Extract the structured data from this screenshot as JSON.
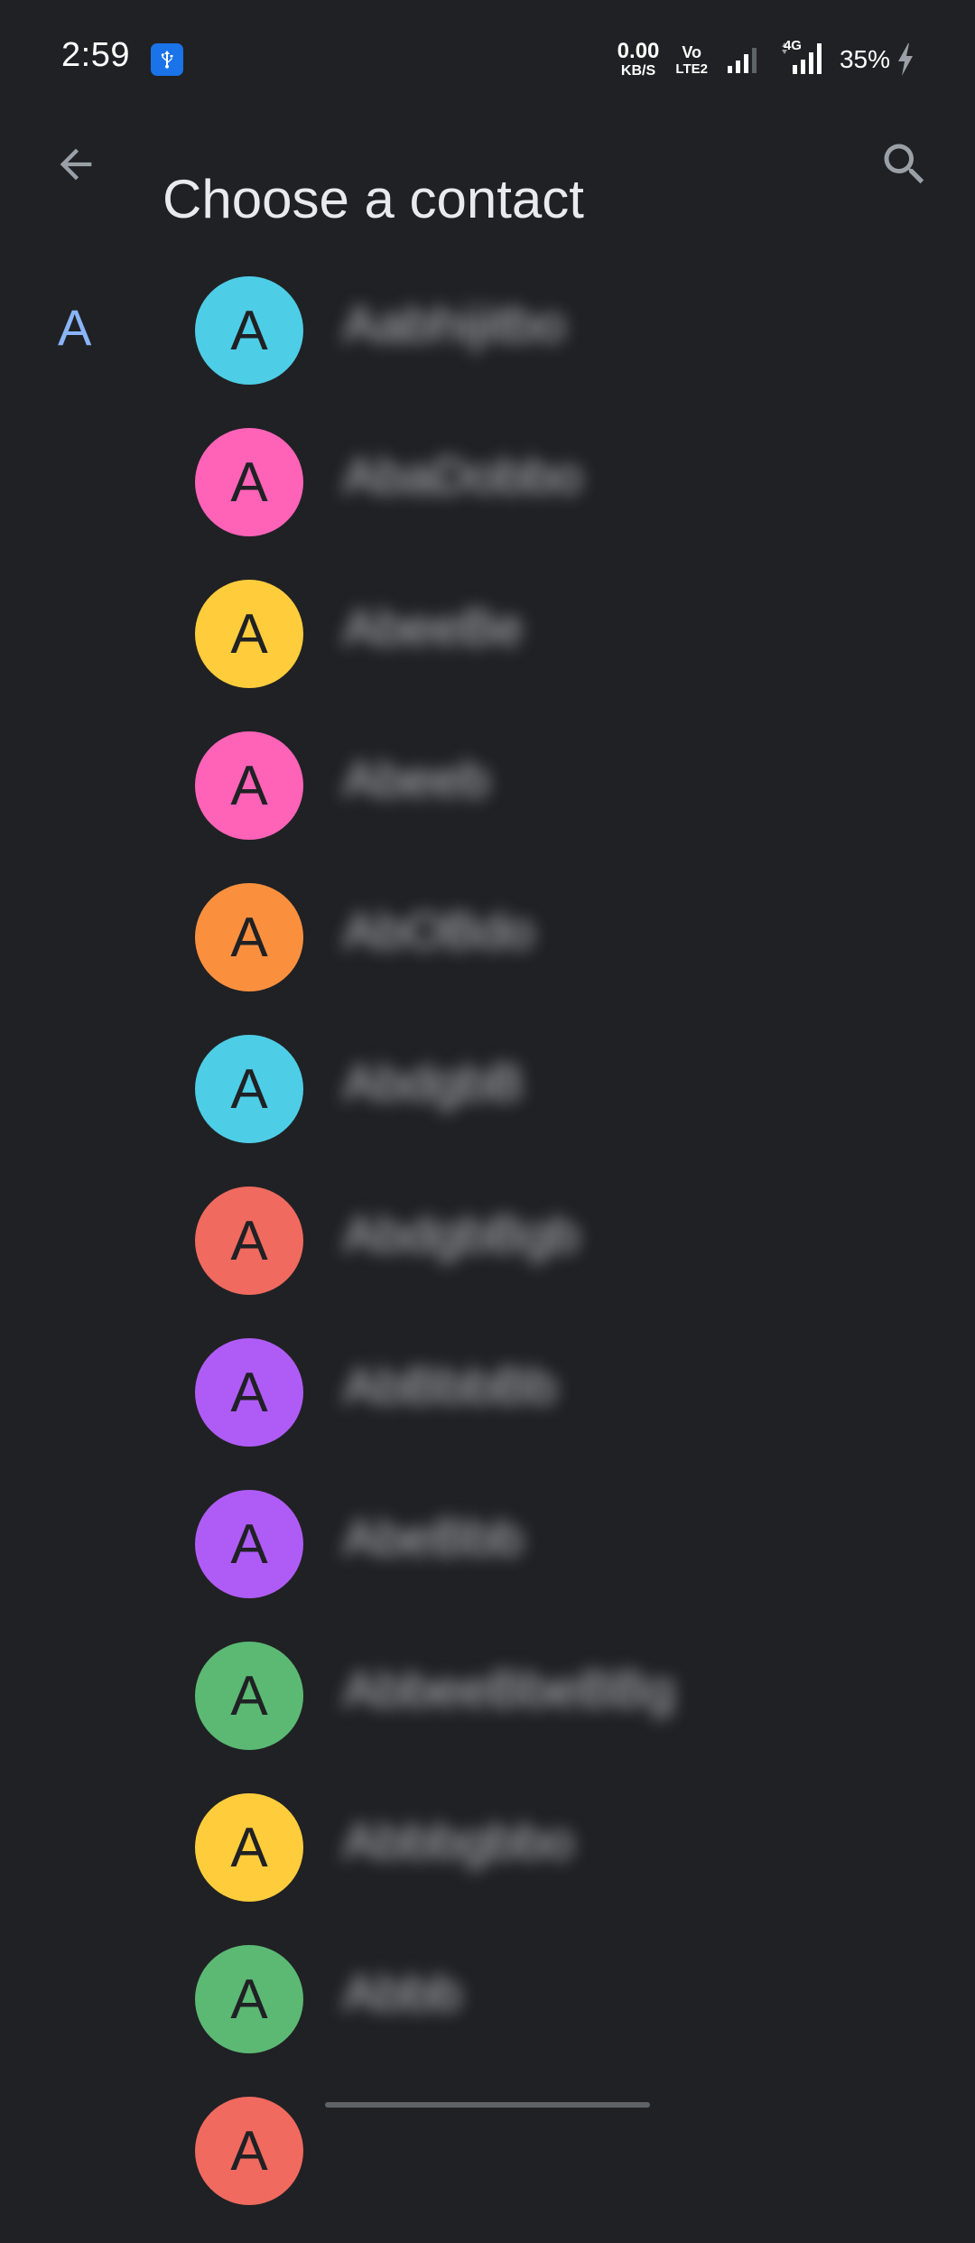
{
  "status_bar": {
    "time": "2:59",
    "net_speed_value": "0.00",
    "net_speed_unit": "KB/S",
    "volte_top": "Vo",
    "volte_bottom": "LTE2",
    "network_type": "4G",
    "battery": "35%",
    "icons": [
      "usb-icon",
      "signal-icon",
      "signal-4g-icon",
      "charging-icon"
    ]
  },
  "header": {
    "title": "Choose a contact",
    "back_icon": "arrow-back-icon",
    "search_icon": "search-icon"
  },
  "section": {
    "letter": "A"
  },
  "contacts": [
    {
      "initial": "A",
      "name": "Aabhijitbo",
      "color": "#4ecde6"
    },
    {
      "initial": "A",
      "name": "AbaDobbo",
      "color": "#ff63b8"
    },
    {
      "initial": "A",
      "name": "AbeeBe",
      "color": "#ffcd3c"
    },
    {
      "initial": "A",
      "name": "Abeeb",
      "color": "#ff63b8"
    },
    {
      "initial": "A",
      "name": "AbOBdo",
      "color": "#fa903e"
    },
    {
      "initial": "A",
      "name": "AbdgbB",
      "color": "#4ecde6"
    },
    {
      "initial": "A",
      "name": "AbdgbBgb",
      "color": "#f06a5f"
    },
    {
      "initial": "A",
      "name": "AbBbbBb",
      "color": "#af5cf7"
    },
    {
      "initial": "A",
      "name": "AbeBbb",
      "color": "#af5cf7"
    },
    {
      "initial": "A",
      "name": "AbbeeBbeBBg",
      "color": "#5bb974"
    },
    {
      "initial": "A",
      "name": "Abbbgbbo",
      "color": "#ffcd3c"
    },
    {
      "initial": "A",
      "name": "Abbb",
      "color": "#5bb974"
    },
    {
      "initial": "A",
      "name": "",
      "color": "#f06a5f"
    }
  ]
}
